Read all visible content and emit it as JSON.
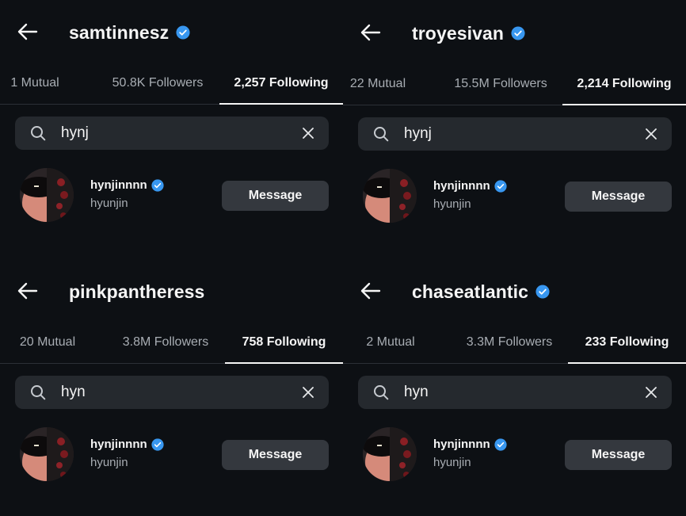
{
  "colors": {
    "background": "#0d1014",
    "verified": "#3897f0",
    "search_bg": "#25292e",
    "button_bg": "#34383e"
  },
  "panels": [
    {
      "username": "samtinnesz",
      "tabs": [
        "1 Mutual",
        "50.8K Followers",
        "2,257 Following"
      ],
      "active_tab": "2,257 Following",
      "search_query": "hynj",
      "result": {
        "username": "hynjinnnn",
        "full_name": "hyunjin",
        "button": "Message"
      }
    },
    {
      "username": "troyesivan",
      "tabs": [
        "22 Mutual",
        "15.5M Followers",
        "2,214 Following"
      ],
      "active_tab": "2,214 Following",
      "search_query": "hynj",
      "result": {
        "username": "hynjinnnn",
        "full_name": "hyunjin",
        "button": "Message"
      }
    },
    {
      "username": "pinkpantheress",
      "tabs": [
        "20 Mutual",
        "3.8M Followers",
        "758 Following"
      ],
      "active_tab": "758 Following",
      "search_query": "hyn",
      "result": {
        "username": "hynjinnnn",
        "full_name": "hyunjin",
        "button": "Message"
      }
    },
    {
      "username": "chaseatlantic",
      "tabs": [
        "2 Mutual",
        "3.3M Followers",
        "233 Following"
      ],
      "active_tab": "233 Following",
      "search_query": "hyn",
      "result": {
        "username": "hynjinnnn",
        "full_name": "hyunjin",
        "button": "Message"
      }
    }
  ],
  "icons": {
    "back": "arrow-left-icon",
    "verified": "verified-badge-icon",
    "search": "search-icon",
    "clear": "close-icon"
  }
}
